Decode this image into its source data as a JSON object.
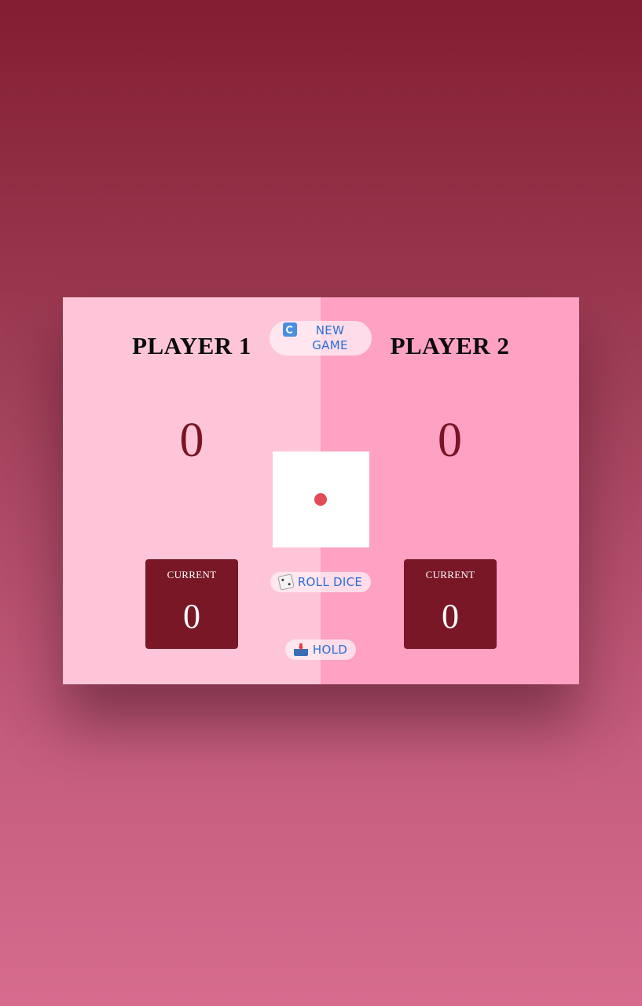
{
  "players": [
    {
      "name": "PLAYER 1",
      "score": "0",
      "current_label": "CURRENT",
      "current_score": "0",
      "panel_color": "#fec5d9"
    },
    {
      "name": "PLAYER 2",
      "score": "0",
      "current_label": "CURRENT",
      "current_score": "0",
      "panel_color": "#fea1c2"
    }
  ],
  "controls": {
    "new_game_label": "NEW GAME",
    "roll_dice_label": "ROLL DICE",
    "hold_label": "HOLD"
  },
  "dice": {
    "value": 1,
    "pip_color": "#e34b55"
  },
  "icons": {
    "new_game": "refresh-icon",
    "roll_dice": "dice-icon",
    "hold": "inbox-icon"
  },
  "colors": {
    "accent_dark": "#7a1726",
    "button_text": "#2b6fd6"
  }
}
